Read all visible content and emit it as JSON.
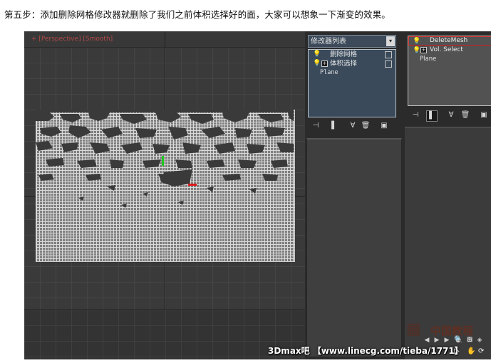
{
  "caption": "第五步：添加删除网格修改器就删除了我们之前体积选择好的面，大家可以想象一下渐变的效果。",
  "viewport": {
    "label": "+ [Perspective] [Smooth]"
  },
  "modifier_panel": {
    "header": "修改器列表",
    "dropdown_icon": "▾",
    "stack": [
      {
        "label": "删除网格",
        "has_plus": false
      },
      {
        "label": "体积选择",
        "has_plus": true
      }
    ],
    "base": "Plane"
  },
  "right_panel": {
    "stack": [
      {
        "label": "DeleteMesh"
      },
      {
        "label": "Vol. Select"
      }
    ],
    "base": "Plane"
  },
  "watermark": "3Dmax吧 【www.linecg.com/tieba/1771】",
  "logo_text": "中国教程"
}
